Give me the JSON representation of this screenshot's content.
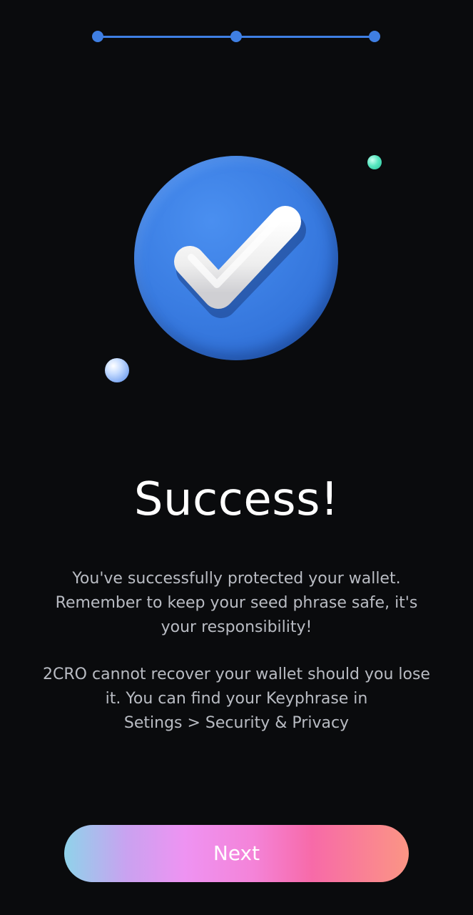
{
  "stepper": {
    "total_steps": 3,
    "completed_steps": 3,
    "color": "#3f7fe3"
  },
  "hero": {
    "icon": "checkmark-icon",
    "circle_color": "#3b7ee3",
    "orb_green_color": "#57e8c0",
    "orb_blue_color": "#c6dcff"
  },
  "title": "Success!",
  "message": {
    "line1": "You've successfully protected your wallet.",
    "line2": "Remember to keep your seed phrase safe, it's",
    "line3": "your responsibility!"
  },
  "notice": {
    "line1": "2CRO cannot recover your wallet should you lose",
    "line2": "it. You can find your Keyphrase in",
    "line3": "Setings > Security & Privacy"
  },
  "next_button": {
    "label": "Next",
    "gradient": [
      "#8fd3ea",
      "#ee93f2",
      "#f76aa8",
      "#fb9584"
    ]
  },
  "background_color": "#0a0b0d"
}
